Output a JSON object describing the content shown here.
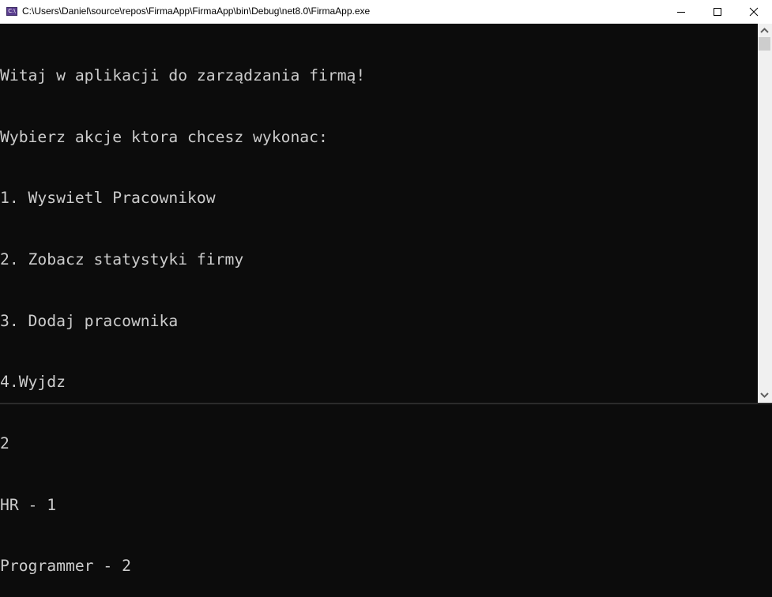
{
  "window": {
    "title": "C:\\Users\\Daniel\\source\\repos\\FirmaApp\\FirmaApp\\bin\\Debug\\net8.0\\FirmaApp.exe",
    "icon_label": "C:\\",
    "icon": "console-app-icon",
    "controls": [
      "minimize-icon",
      "maximize-icon",
      "close-icon"
    ]
  },
  "console": {
    "lines": [
      "Witaj w aplikacji do zarządzania firmą!",
      "Wybierz akcje ktora chcesz wykonac:",
      "1. Wyswietl Pracownikow",
      "2. Zobacz statystyki firmy",
      "3. Dodaj pracownika",
      "4.Wyjdz",
      "2",
      "HR - 1",
      "Programmer - 2"
    ],
    "background": "#0c0c0c",
    "foreground": "#cccccc"
  }
}
